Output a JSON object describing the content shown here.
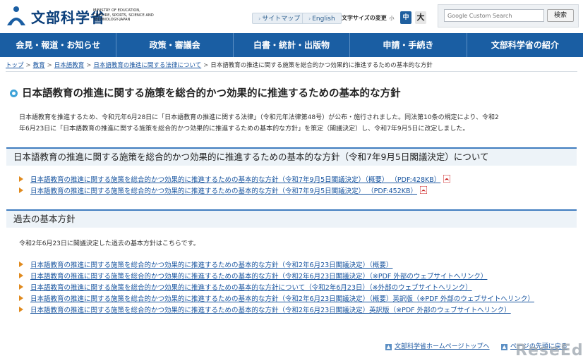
{
  "header": {
    "logo_jp": "文部科学省",
    "logo_en": "MINISTRY OF EDUCATION, CULTURE, SPORTS, SCIENCE AND TECHNOLOGY-JAPAN",
    "sitemap_label": "サイトマップ",
    "english_label": "English",
    "font_size_label": "文字サイズの変更",
    "font_small": "小",
    "font_mid": "中",
    "font_large": "大",
    "search_placeholder": "Google Custom Search",
    "search_button": "検索"
  },
  "nav": {
    "items": [
      {
        "label": "会見・報道・お知らせ"
      },
      {
        "label": "政策・審議会"
      },
      {
        "label": "白書・統計・出版物"
      },
      {
        "label": "申請・手続き"
      },
      {
        "label": "文部科学省の紹介"
      }
    ]
  },
  "breadcrumb": {
    "items": [
      "トップ",
      "教育",
      "日本語教育",
      "日本語教育の推進に関する法律について"
    ],
    "current": "日本語教育の推進に関する施策を総合的かつ効果的に推進するための基本的な方針"
  },
  "page": {
    "title": "日本語教育の推進に関する施策を総合的かつ効果的に推進するための基本的な方針",
    "intro_line1": "日本語教育を推進するため、令和元年6月28日に「日本語教育の推進に関する法律」（令和元年法律第48号）が公布・施行されました。同法第10条の規定により、令和2",
    "intro_line2": "年6月23日に「日本語教育の推進に関する施策を総合的かつ効果的に推進するための基本的な方針」を策定（閣議決定）し、令和7年9月5日に改定しました。"
  },
  "section1": {
    "heading": "日本語教育の推進に関する施策を総合的かつ効果的に推進するための基本的な方針（令和7年9月5日閣議決定）について",
    "links": [
      {
        "text": "日本語教育の推進に関する施策を総合的かつ効果的に推進するための基本的な方針（令和7年9月5日閣議決定）（概要） （PDF:428KB）"
      },
      {
        "text": "日本語教育の推進に関する施策を総合的かつ効果的に推進するための基本的な方針（令和7年9月5日閣議決定） （PDF:452KB）"
      }
    ]
  },
  "section2": {
    "heading": "過去の基本方針",
    "text": "令和2年6月23日に閣議決定した過去の基本方針はこちらです。",
    "links": [
      {
        "text": "日本語教育の推進に関する施策を総合的かつ効果的に推進するための基本的な方針（令和2年6月23日閣議決定）（概要）"
      },
      {
        "text": "日本語教育の推進に関する施策を総合的かつ効果的に推進するための基本的な方針（令和2年6月23日閣議決定）（※PDF 外部のウェブサイトへリンク）"
      },
      {
        "text": "日本語教育の推進に関する施策を総合的かつ効果的に推進するための基本的な方針について（令和2年6月23日）（※外部のウェブサイトへリンク）"
      },
      {
        "text": "日本語教育の推進に関する施策を総合的かつ効果的に推進するための基本的な方針（令和2年6月23日閣議決定）（概要）英訳版（※PDF 外部のウェブサイトへリンク）"
      },
      {
        "text": "日本語教育の推進に関する施策を総合的かつ効果的に推進するための基本的な方針（令和2年6月23日閣議決定）英訳版（※PDF 外部のウェブサイトへリンク）"
      }
    ]
  },
  "footer": {
    "home_link": "文部科学省ホームページトップへ",
    "top_link": "ページの先頭に戻る"
  },
  "watermark": "ReseEd",
  "colors": {
    "nav_bg": "#1a5ea3",
    "link": "#1a56a0",
    "bullet": "#e08a1e",
    "section_border": "#3f7cbf",
    "section_bg": "#edf3f8"
  }
}
